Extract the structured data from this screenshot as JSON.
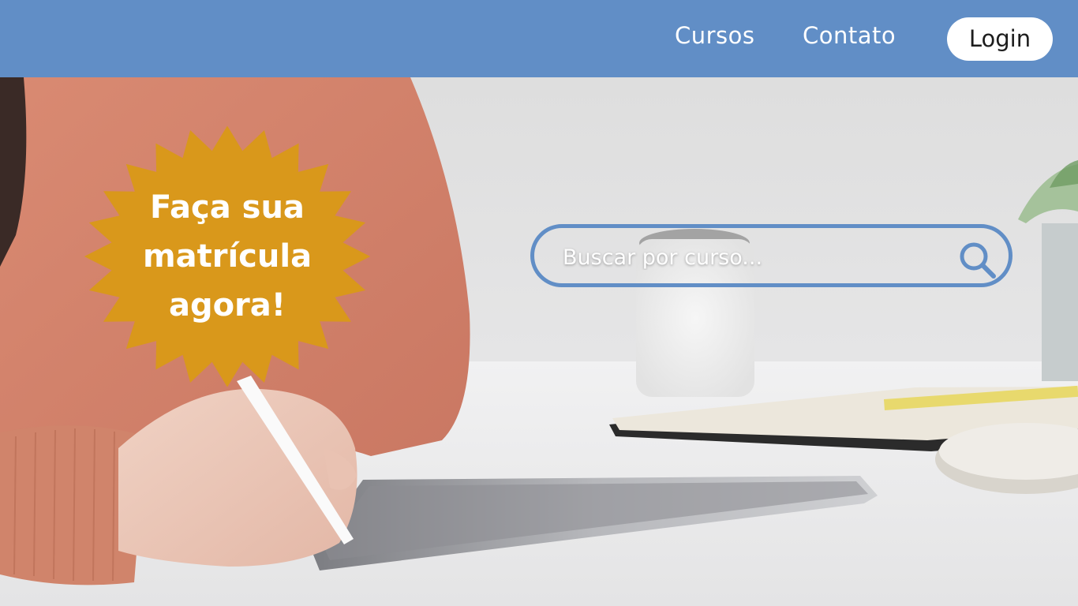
{
  "header": {
    "nav": [
      {
        "label": "Cursos"
      },
      {
        "label": "Contato"
      }
    ],
    "login_label": "Login"
  },
  "badge": {
    "lines": [
      "Faça sua",
      "matrícula",
      "agora!"
    ]
  },
  "search": {
    "placeholder": "Buscar por curso...",
    "value": ""
  },
  "colors": {
    "header_bg": "#618ec6",
    "badge_fill": "#d9981b",
    "search_border": "#618ec6",
    "login_bg": "#ffffff"
  },
  "icons": {
    "search": "search-icon",
    "badge": "starburst-badge"
  }
}
